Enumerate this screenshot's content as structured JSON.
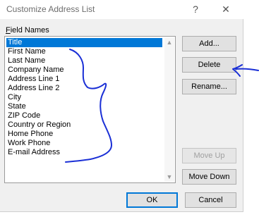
{
  "window": {
    "title": "Customize Address List",
    "help_glyph": "?",
    "close_glyph": "✕"
  },
  "field_list": {
    "label": "Field Names",
    "items": [
      "Title",
      "First Name",
      "Last Name",
      "Company Name",
      "Address Line 1",
      "Address Line 2",
      "City",
      "State",
      "ZIP Code",
      "Country or Region",
      "Home Phone",
      "Work Phone",
      "E-mail Address"
    ],
    "selected_index": 0
  },
  "buttons": {
    "add": "Add...",
    "delete": "Delete",
    "rename": "Rename...",
    "move_up": "Move Up",
    "move_down": "Move Down",
    "ok": "OK",
    "cancel": "Cancel"
  },
  "annotation_color": "#1a2fd6"
}
